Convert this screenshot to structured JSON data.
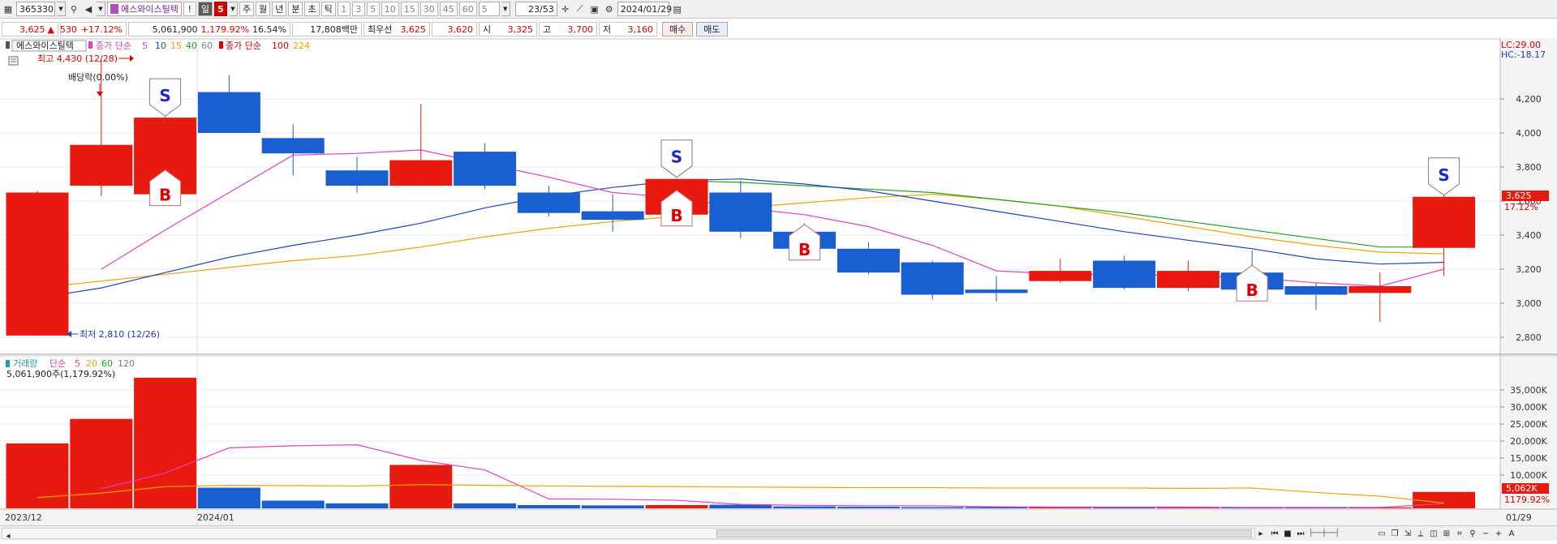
{
  "toolbar": {
    "stock_code": "365330",
    "stock_name": "에스와이스틸텍",
    "alert": "!",
    "period_selected": "일",
    "period_count": "5",
    "periods": [
      "주",
      "월",
      "년",
      "분",
      "초",
      "틱"
    ],
    "intervals": [
      "1",
      "3",
      "5",
      "10",
      "15",
      "30",
      "45",
      "60"
    ],
    "interval_value": "5",
    "page_counter": "23/53",
    "date": "2024/01/29"
  },
  "quote": {
    "price": "3,625",
    "arrow": "▲",
    "change": "530",
    "change_pct": "+17.12%",
    "volume": "5,061,900",
    "volume_ratio": "1,179.92%",
    "turnover": "16.54%",
    "amount": "17,808백만",
    "best": "최우선",
    "ask": "3,625",
    "bid": "3,620",
    "open_label": "시",
    "open": "3,325",
    "high_label": "고",
    "high": "3,700",
    "low_label": "저",
    "low": "3,160",
    "buy_button": "매수",
    "sell_button": "매도"
  },
  "price_panel": {
    "title_chip": "에스와이스틸텍",
    "ma_label": "종가 단순",
    "ma_periods": [
      "5",
      "10",
      "15",
      "40",
      "60"
    ],
    "ma_colors": [
      "#e040c0",
      "#2040c0",
      "#f0a000",
      "#20a020",
      "#808080"
    ],
    "ma2_label": "종가 단순",
    "ma2_periods": [
      "100",
      "224"
    ],
    "ma2_colors": [
      "#e00000",
      "#f0a000"
    ],
    "high_note": "최고 4,430 (12/28)",
    "low_note": "최저 2,810 (12/26)",
    "dividend_note": "배당락(0.00%)",
    "lc": "LC:29.00",
    "hc": "HC:-18.17",
    "price_tag": "3,625",
    "pct_tag": "17.12%"
  },
  "volume_panel": {
    "label": "거래량",
    "ma_label": "단순",
    "ma_periods": [
      "5",
      "20",
      "60",
      "120"
    ],
    "ma_colors": [
      "#e040c0",
      "#f0a000",
      "#20a020",
      "#808080"
    ],
    "value_note": "5,061,900주(1,179.92%)",
    "vol_tag": "5,062K",
    "ratio_tag": "1179.92%"
  },
  "date_axis": [
    "2023/12",
    "2024/01"
  ],
  "date_end": "01/29",
  "colors": {
    "up": "#e8190f",
    "down": "#1a5fd1",
    "signal_buy": "#e00000",
    "signal_sell": "#1a2ad0"
  },
  "chart_data": {
    "type": "candlestick",
    "ylim": [
      2700,
      4400
    ],
    "yticks": [
      "4,200",
      "4,000",
      "3,800",
      "3,600",
      "3,400",
      "3,200",
      "3,000",
      "2,800"
    ],
    "candles": [
      {
        "o": 2810,
        "h": 3660,
        "l": 2810,
        "c": 3650
      },
      {
        "o": 3690,
        "h": 4430,
        "l": 3630,
        "c": 3930
      },
      {
        "o": 3640,
        "h": 4290,
        "l": 3640,
        "c": 4090
      },
      {
        "o": 4240,
        "h": 4340,
        "l": 4000,
        "c": 4000
      },
      {
        "o": 3970,
        "h": 4050,
        "l": 3750,
        "c": 3880
      },
      {
        "o": 3780,
        "h": 3860,
        "l": 3650,
        "c": 3690
      },
      {
        "o": 3690,
        "h": 4170,
        "l": 3690,
        "c": 3840
      },
      {
        "o": 3890,
        "h": 3940,
        "l": 3670,
        "c": 3690
      },
      {
        "o": 3650,
        "h": 3690,
        "l": 3510,
        "c": 3530
      },
      {
        "o": 3540,
        "h": 3640,
        "l": 3420,
        "c": 3490
      },
      {
        "o": 3520,
        "h": 3730,
        "l": 3510,
        "c": 3730
      },
      {
        "o": 3650,
        "h": 3720,
        "l": 3380,
        "c": 3420
      },
      {
        "o": 3420,
        "h": 3470,
        "l": 3310,
        "c": 3320
      },
      {
        "o": 3320,
        "h": 3360,
        "l": 3170,
        "c": 3180
      },
      {
        "o": 3240,
        "h": 3250,
        "l": 3020,
        "c": 3050
      },
      {
        "o": 3080,
        "h": 3160,
        "l": 3010,
        "c": 3060
      },
      {
        "o": 3130,
        "h": 3260,
        "l": 3120,
        "c": 3190
      },
      {
        "o": 3250,
        "h": 3280,
        "l": 3080,
        "c": 3090
      },
      {
        "o": 3090,
        "h": 3250,
        "l": 3070,
        "c": 3190
      },
      {
        "o": 3180,
        "h": 3310,
        "l": 3080,
        "c": 3080
      },
      {
        "o": 3100,
        "h": 3120,
        "l": 2960,
        "c": 3050
      },
      {
        "o": 3060,
        "h": 3180,
        "l": 2890,
        "c": 3100
      },
      {
        "o": 3325,
        "h": 3700,
        "l": 3160,
        "c": 3625
      }
    ],
    "signals": [
      {
        "i": 2,
        "type": "S",
        "pos": "above"
      },
      {
        "i": 2,
        "type": "B",
        "pos": "below"
      },
      {
        "i": 10,
        "type": "S",
        "pos": "above"
      },
      {
        "i": 10,
        "type": "B",
        "pos": "below"
      },
      {
        "i": 12,
        "type": "B",
        "pos": "below"
      },
      {
        "i": 19,
        "type": "B",
        "pos": "below"
      },
      {
        "i": 22,
        "type": "S",
        "pos": "above"
      }
    ],
    "ma5": [
      null,
      3200,
      3430,
      3650,
      3870,
      3880,
      3900,
      3820,
      3740,
      3650,
      3620,
      3560,
      3520,
      3450,
      3340,
      3190,
      3170,
      3170,
      3160,
      3150,
      3120,
      3100,
      3200
    ],
    "ma10": [
      3030,
      3090,
      3180,
      3270,
      3340,
      3400,
      3470,
      3560,
      3630,
      3680,
      3720,
      3730,
      3700,
      3660,
      3600,
      3540,
      3480,
      3420,
      3370,
      3320,
      3260,
      3230,
      3240
    ],
    "ma15": [
      null,
      null,
      null,
      null,
      null,
      null,
      null,
      null,
      null,
      null,
      3720,
      3710,
      3690,
      3670,
      3650,
      3610,
      3570,
      3530,
      3480,
      3430,
      3380,
      3330,
      3330
    ],
    "ma_orange": [
      3090,
      3130,
      3170,
      3210,
      3250,
      3280,
      3330,
      3390,
      3440,
      3480,
      3510,
      3560,
      3590,
      3620,
      3640,
      3610,
      3570,
      3510,
      3450,
      3390,
      3340,
      3300,
      3290
    ],
    "volume_ylim": [
      0,
      40000
    ],
    "volume_yticks": [
      "35,000K",
      "30,000K",
      "25,000K",
      "20,000K",
      "15,000K",
      "10,000K"
    ],
    "volumes": [
      19300,
      26500,
      38600,
      6300,
      2500,
      1700,
      13000,
      1700,
      1200,
      1100,
      1200,
      1300,
      800,
      700,
      600,
      600,
      700,
      600,
      500,
      500,
      500,
      500,
      5062
    ],
    "vol_ma5": [
      null,
      6000,
      10600,
      18000,
      18600,
      18900,
      14300,
      11500,
      3000,
      2900,
      2600,
      1400,
      1100,
      1000,
      1000,
      700,
      600,
      600,
      600,
      500,
      500,
      500,
      1600
    ],
    "vol_ma20": [
      3400,
      4700,
      6600,
      7000,
      6900,
      6800,
      7200,
      7000,
      6800,
      6700,
      6600,
      6500,
      6400,
      6300,
      6300,
      6200,
      6200,
      6200,
      6100,
      6200,
      4900,
      3800,
      1800
    ]
  }
}
